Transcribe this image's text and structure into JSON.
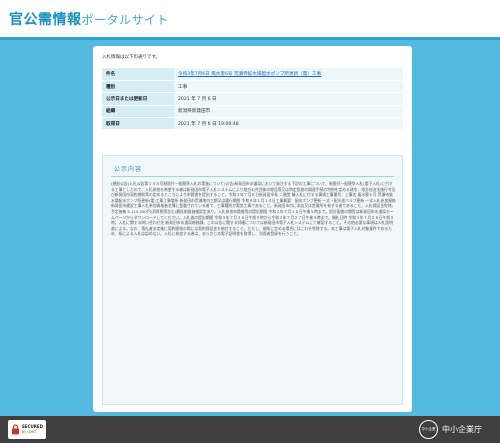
{
  "header": {
    "title_main": "官公需情報",
    "title_sub": "ポータルサイト"
  },
  "card": {
    "intro": "入札情報は以下の通りです。",
    "rows": [
      {
        "label": "件名",
        "value": "令和3年7月6日 風水害6号 荒瀬寺鉱水場配水ポンプ所更新（電）工事",
        "link": true
      },
      {
        "label": "種別",
        "value": "工事",
        "link": false
      },
      {
        "label": "公示日または更新日",
        "value": "2021 年 7 月 6 日",
        "link": false
      },
      {
        "label": "組織",
        "value": "新潟県新発田市",
        "link": false
      },
      {
        "label": "取得日",
        "value": "2021 年 7 月 6 日 19:09:48",
        "link": false
      }
    ]
  },
  "notice": {
    "title": "公示内容",
    "body": "(規則公告)入札公告第１４８号制限付一般競争入札の実施について(公告)新発田市水道局において発注する下記の工事について、制限付一般競争入札(電子入札)に付する工事としたので、入札参加を希望する者は新発田市電子入札システムにより地方公共団体の物品等又は特定役務の調達手続の特例を定める政令、地方自治法施行令及び新発田市契約規則等の定めるところにより申請書を提出すること。令和３年７月６日新発田市長 二階堂 馨入札に付する事項工事番号：工事名 風水害６号 荒瀬寺鉱水場配水ポンプ所更新(電)工事工事場所 新発田市荒瀬地内工期又は履行期限 令和４年１月１４日工事概要：配水ポンプ更新 一式・配水池バルブ更新 一式入札参加資格新発田市建設工事入札参加資格者名簿に登載されている者で、工事種別が電気工事であること。新発田市内に本店又は営業所を有する者であること。入札保証金免除。予定価格 5,115,000円(消費税等含む)最低制限価格設定あり。入札参加申請書等の提出期限 令和３年７月１５日午後５時まで。設計図書の閲覧は新発田市水道局ホームページからダウンロードしてください。入札書の提出期間 令和３年７月２６日午前９時から令和３年７月２７日午後５時まで。開札日時 令和３年７月２８日午前９時。入札に関する問い合わせ先 新発田市水道局総務課。この公告に関する詳細については新発田市電子入札システムにて確認すること。その他必要な事項は入札説明書による。なお、落札者決定後に契約締結の際には契約保証金を納付すること。ただし、規則に定める場合にはこれを免除する。本工事は電子入札対象案件であるため、紙による入札は認めない。入札に参加する者は、あらかじめ電子証明書を取得し、利用者登録を行うこと。"
  },
  "footer": {
    "secured_line1": "SECURED",
    "secured_line2": "by GMO",
    "emblem_text": "中小企業庁",
    "agency_name": "中小企業庁"
  },
  "colors": {
    "background": "#53b9de",
    "accent": "#1a8fbe",
    "footer": "#3f3f3f"
  }
}
